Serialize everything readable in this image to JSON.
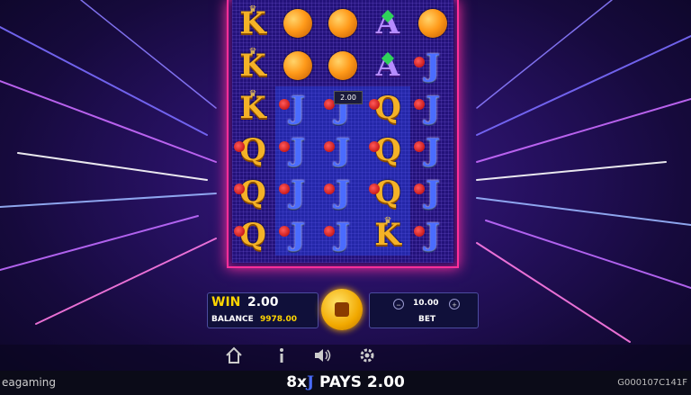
{
  "grid": [
    [
      "K",
      "O",
      "O",
      "A",
      "O"
    ],
    [
      "K",
      "O",
      "O",
      "A",
      "J"
    ],
    [
      "K",
      "J",
      "J",
      "Q",
      "J"
    ],
    [
      "Q",
      "J",
      "J",
      "Q",
      "J"
    ],
    [
      "Q",
      "J",
      "J",
      "Q",
      "J"
    ],
    [
      "Q",
      "J",
      "J",
      "K",
      "J"
    ]
  ],
  "highlight_columns": [
    1,
    2,
    3
  ],
  "tooltip": "2.00",
  "win": {
    "label": "WIN",
    "value": "2.00"
  },
  "balance": {
    "label": "BALANCE",
    "value": "9978.00"
  },
  "bet": {
    "label": "BET",
    "value": "10.00",
    "minus": "−",
    "plus": "+"
  },
  "icons": [
    "home-icon",
    "info-icon",
    "sound-icon",
    "settings-icon"
  ],
  "footer": {
    "brand": "eagaming",
    "pays_prefix": "8x",
    "pays_symbol": "J",
    "pays_text": "PAYS 2.00",
    "game_id": "G000107C141F"
  },
  "colors": {
    "frame": "#ff2e9a",
    "gold": "#ffd500",
    "bg": "#25105e"
  }
}
